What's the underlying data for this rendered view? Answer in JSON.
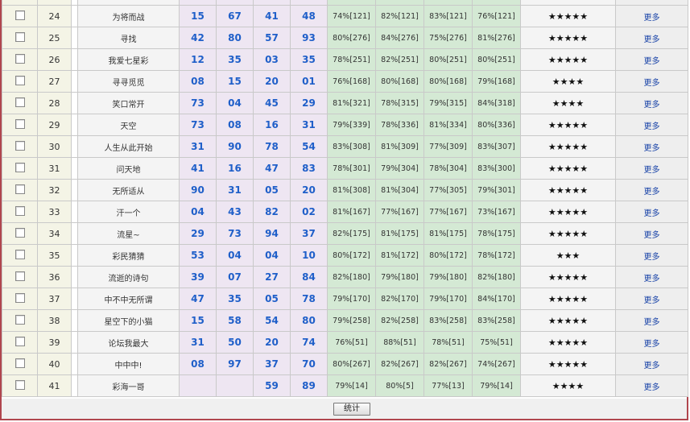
{
  "rows": [
    {
      "num": "24",
      "name": "为将而战",
      "balls": [
        "15",
        "67",
        "41",
        "48"
      ],
      "rates": [
        "74%[121]",
        "82%[121]",
        "83%[121]",
        "76%[121]"
      ],
      "stars": "★★★★★",
      "more": "更多"
    },
    {
      "num": "25",
      "name": "寻找",
      "balls": [
        "42",
        "80",
        "57",
        "93"
      ],
      "rates": [
        "80%[276]",
        "84%[276]",
        "75%[276]",
        "81%[276]"
      ],
      "stars": "★★★★★",
      "more": "更多"
    },
    {
      "num": "26",
      "name": "我爱七星彩",
      "balls": [
        "12",
        "35",
        "03",
        "35"
      ],
      "rates": [
        "78%[251]",
        "82%[251]",
        "80%[251]",
        "80%[251]"
      ],
      "stars": "★★★★★",
      "more": "更多"
    },
    {
      "num": "27",
      "name": "寻寻觅觅",
      "balls": [
        "08",
        "15",
        "20",
        "01"
      ],
      "rates": [
        "76%[168]",
        "80%[168]",
        "80%[168]",
        "79%[168]"
      ],
      "stars": "★★★★",
      "more": "更多"
    },
    {
      "num": "28",
      "name": "笑口常开",
      "balls": [
        "73",
        "04",
        "45",
        "29"
      ],
      "rates": [
        "81%[321]",
        "78%[315]",
        "79%[315]",
        "84%[318]"
      ],
      "stars": "★★★★",
      "more": "更多"
    },
    {
      "num": "29",
      "name": "天空",
      "balls": [
        "73",
        "08",
        "16",
        "31"
      ],
      "rates": [
        "79%[339]",
        "78%[336]",
        "81%[334]",
        "80%[336]"
      ],
      "stars": "★★★★★",
      "more": "更多"
    },
    {
      "num": "30",
      "name": "人生从此开始",
      "balls": [
        "31",
        "90",
        "78",
        "54"
      ],
      "rates": [
        "83%[308]",
        "81%[309]",
        "77%[309]",
        "83%[307]"
      ],
      "stars": "★★★★★",
      "more": "更多"
    },
    {
      "num": "31",
      "name": "问天地",
      "balls": [
        "41",
        "16",
        "47",
        "83"
      ],
      "rates": [
        "78%[301]",
        "79%[304]",
        "78%[304]",
        "83%[300]"
      ],
      "stars": "★★★★★",
      "more": "更多"
    },
    {
      "num": "32",
      "name": "无所适从",
      "balls": [
        "90",
        "31",
        "05",
        "20"
      ],
      "rates": [
        "81%[308]",
        "81%[304]",
        "77%[305]",
        "79%[301]"
      ],
      "stars": "★★★★★",
      "more": "更多"
    },
    {
      "num": "33",
      "name": "汗一个",
      "balls": [
        "04",
        "43",
        "82",
        "02"
      ],
      "rates": [
        "81%[167]",
        "77%[167]",
        "77%[167]",
        "73%[167]"
      ],
      "stars": "★★★★★",
      "more": "更多"
    },
    {
      "num": "34",
      "name": "流星~",
      "balls": [
        "29",
        "73",
        "94",
        "37"
      ],
      "rates": [
        "82%[175]",
        "81%[175]",
        "81%[175]",
        "78%[175]"
      ],
      "stars": "★★★★★",
      "more": "更多"
    },
    {
      "num": "35",
      "name": "彩民猜猜",
      "balls": [
        "53",
        "04",
        "04",
        "10"
      ],
      "rates": [
        "80%[172]",
        "81%[172]",
        "80%[172]",
        "78%[172]"
      ],
      "stars": "★★★",
      "more": "更多"
    },
    {
      "num": "36",
      "name": "流逝的诗句",
      "balls": [
        "39",
        "07",
        "27",
        "84"
      ],
      "rates": [
        "82%[180]",
        "79%[180]",
        "79%[180]",
        "82%[180]"
      ],
      "stars": "★★★★★",
      "more": "更多"
    },
    {
      "num": "37",
      "name": "中不中无所谓",
      "balls": [
        "47",
        "35",
        "05",
        "78"
      ],
      "rates": [
        "79%[170]",
        "82%[170]",
        "79%[170]",
        "84%[170]"
      ],
      "stars": "★★★★★",
      "more": "更多"
    },
    {
      "num": "38",
      "name": "星空下的小猫",
      "balls": [
        "15",
        "58",
        "54",
        "80"
      ],
      "rates": [
        "79%[258]",
        "82%[258]",
        "83%[258]",
        "83%[258]"
      ],
      "stars": "★★★★★",
      "more": "更多"
    },
    {
      "num": "39",
      "name": "论坛我最大",
      "balls": [
        "31",
        "50",
        "20",
        "74"
      ],
      "rates": [
        "76%[51]",
        "88%[51]",
        "78%[51]",
        "75%[51]"
      ],
      "stars": "★★★★★",
      "more": "更多"
    },
    {
      "num": "40",
      "name": "中中中!",
      "balls": [
        "08",
        "97",
        "37",
        "70"
      ],
      "rates": [
        "80%[267]",
        "82%[267]",
        "82%[267]",
        "74%[267]"
      ],
      "stars": "★★★★★",
      "more": "更多"
    },
    {
      "num": "41",
      "name": "彩海一哥",
      "balls": [
        "",
        "",
        "59",
        "89"
      ],
      "rates": [
        "79%[14]",
        "80%[5]",
        "77%[13]",
        "79%[14]"
      ],
      "stars": "★★★★",
      "more": "更多"
    }
  ],
  "footer": {
    "button_label": "统计"
  },
  "colors": {
    "frame": "#b0464e",
    "ball_text": "#1f5fc9",
    "more_link": "#1a44a8"
  }
}
